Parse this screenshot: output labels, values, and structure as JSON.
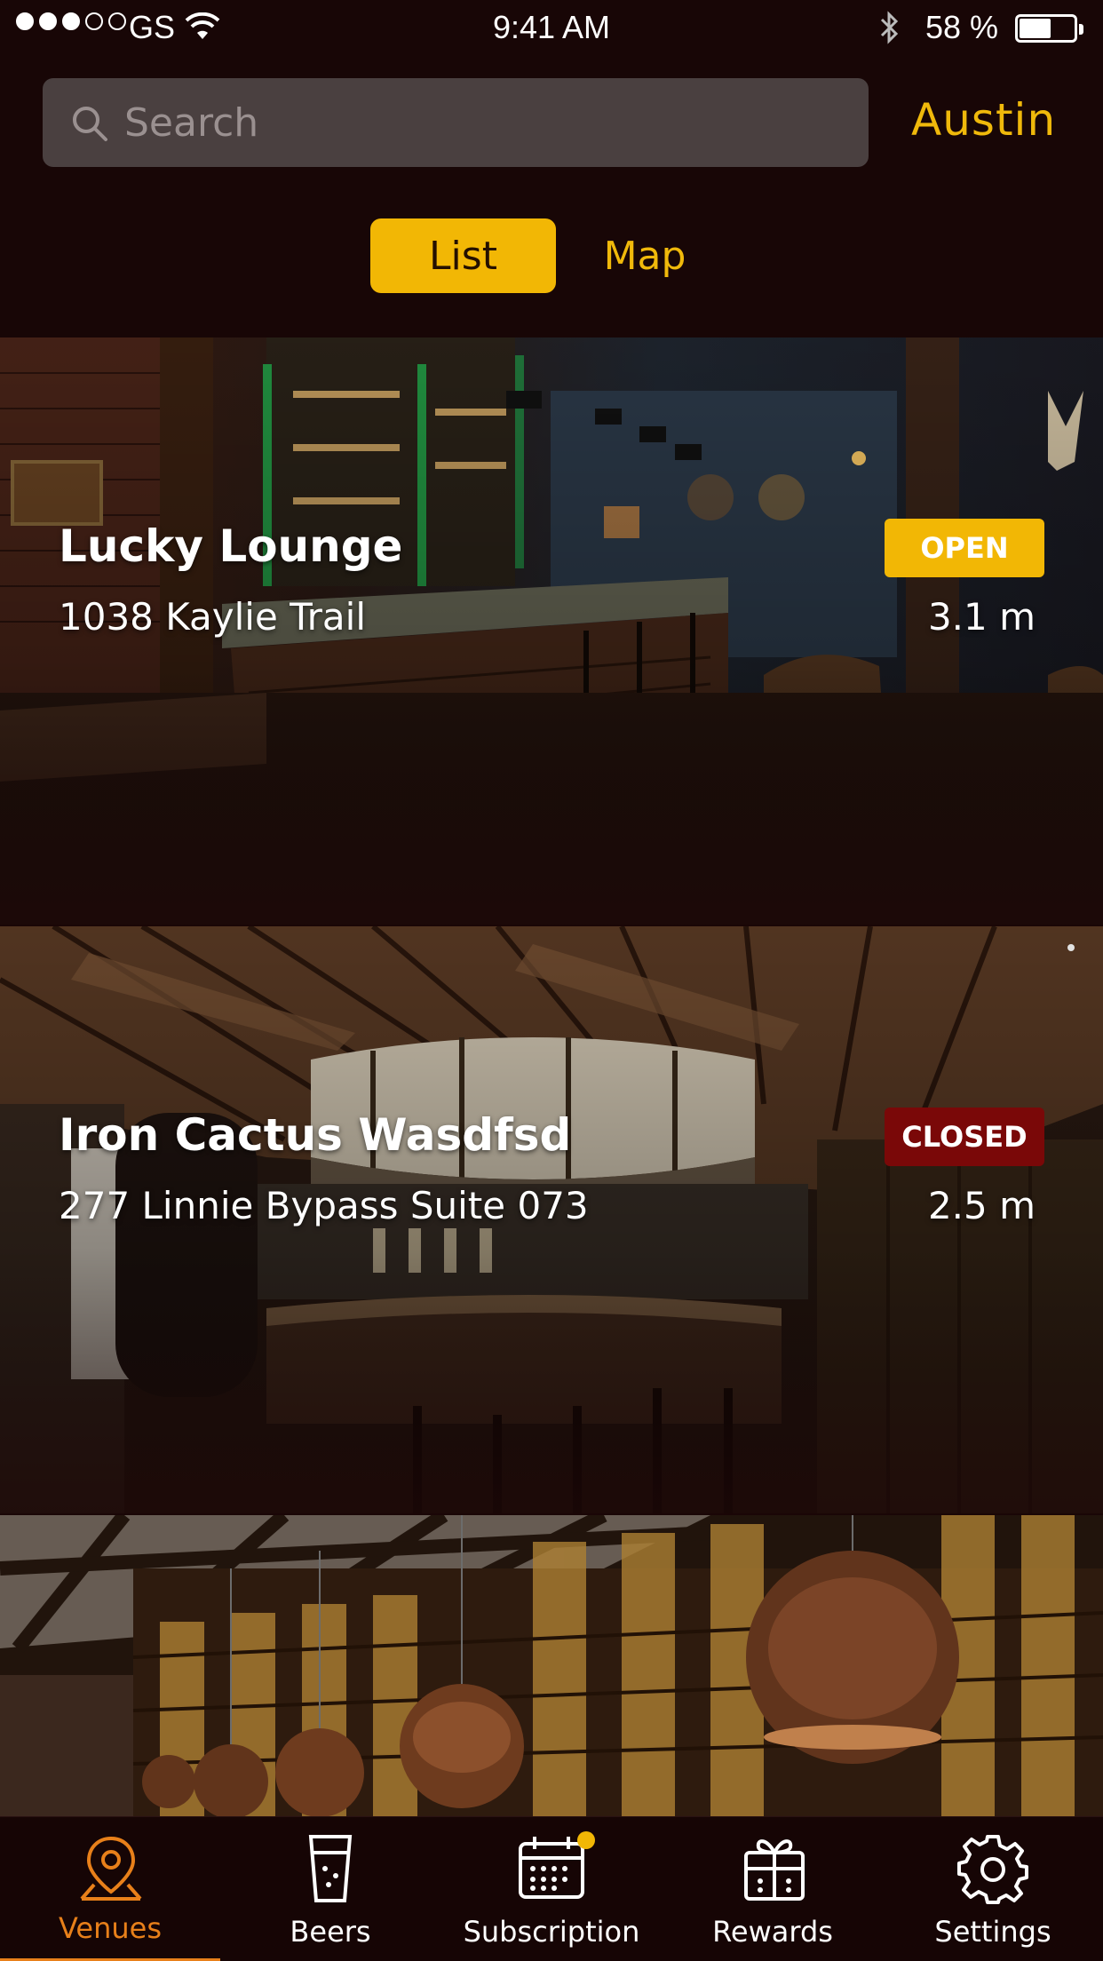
{
  "status_bar": {
    "carrier": "GS",
    "time": "9:41 AM",
    "battery_percent": "58 %",
    "battery_level": 0.58,
    "signal_bars": 3,
    "signal_total": 5
  },
  "header": {
    "search_placeholder": "Search",
    "city": "Austin"
  },
  "view_toggle": {
    "list_label": "List",
    "map_label": "Map",
    "selected": "List"
  },
  "venues": [
    {
      "name": "Lucky Lounge",
      "address": "1038 Kaylie Trail",
      "distance": "3.1 m",
      "status": "OPEN"
    },
    {
      "name": "Iron Cactus Wasdfsd",
      "address": "277 Linnie Bypass Suite 073",
      "distance": "2.5 m",
      "status": "CLOSED"
    },
    {
      "name": "",
      "address": "",
      "distance": "",
      "status": ""
    }
  ],
  "tabbar": {
    "tabs": [
      {
        "label": "Venues",
        "icon": "map-pin-icon",
        "active": true
      },
      {
        "label": "Beers",
        "icon": "beer-glass-icon",
        "active": false
      },
      {
        "label": "Subscription",
        "icon": "calendar-icon",
        "active": false,
        "badge": true
      },
      {
        "label": "Rewards",
        "icon": "gift-icon",
        "active": false
      },
      {
        "label": "Settings",
        "icon": "gear-icon",
        "active": false
      }
    ]
  },
  "colors": {
    "accent": "#f2b705",
    "active_tab": "#e8801a",
    "closed": "#7a0808",
    "background": "#180606"
  }
}
